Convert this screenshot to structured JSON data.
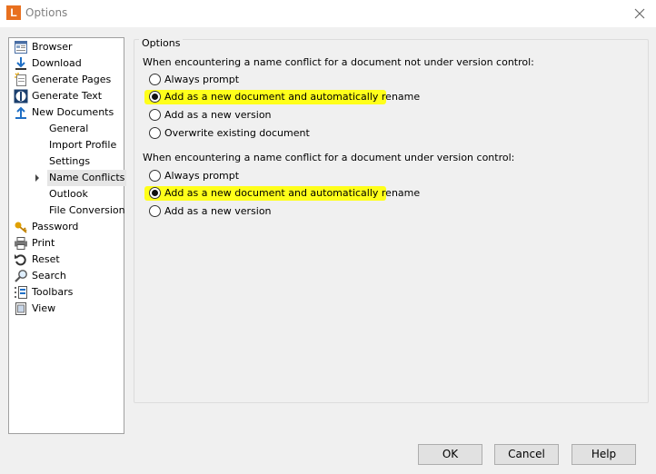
{
  "window": {
    "title": "Options",
    "app_icon_letter": "L"
  },
  "nav": {
    "items": [
      {
        "label": "Browser",
        "icon": "browser-icon"
      },
      {
        "label": "Download",
        "icon": "download-icon"
      },
      {
        "label": "Generate Pages",
        "icon": "generate-pages-icon"
      },
      {
        "label": "Generate Text",
        "icon": "generate-text-icon"
      },
      {
        "label": "New Documents",
        "icon": "new-documents-icon"
      },
      {
        "label": "General"
      },
      {
        "label": "Import Profile"
      },
      {
        "label": "Settings"
      },
      {
        "label": "Name Conflicts",
        "selected": true
      },
      {
        "label": "Outlook"
      },
      {
        "label": "File Conversion"
      },
      {
        "label": "Password",
        "icon": "password-icon"
      },
      {
        "label": "Print",
        "icon": "print-icon"
      },
      {
        "label": "Reset",
        "icon": "reset-icon"
      },
      {
        "label": "Search",
        "icon": "search-icon"
      },
      {
        "label": "Toolbars",
        "icon": "toolbars-icon"
      },
      {
        "label": "View",
        "icon": "view-icon"
      }
    ]
  },
  "options": {
    "group_title": "Options",
    "section1": {
      "question": "When encountering a name conflict for a document not under version control:",
      "choices": [
        {
          "label": "Always prompt",
          "checked": false
        },
        {
          "label": "Add as a new document and automatically rename",
          "checked": true
        },
        {
          "label": "Add as a new version",
          "checked": false
        },
        {
          "label": "Overwrite existing document",
          "checked": false
        }
      ]
    },
    "section2": {
      "question": "When encountering a name conflict for a document under version control:",
      "choices": [
        {
          "label": "Always prompt",
          "checked": false
        },
        {
          "label": "Add as a new document and automatically rename",
          "checked": true
        },
        {
          "label": "Add as a new version",
          "checked": false
        }
      ]
    }
  },
  "buttons": {
    "ok": "OK",
    "cancel": "Cancel",
    "help": "Help"
  },
  "colors": {
    "highlight": "#ffff1a",
    "app_icon": "#e8701f"
  }
}
